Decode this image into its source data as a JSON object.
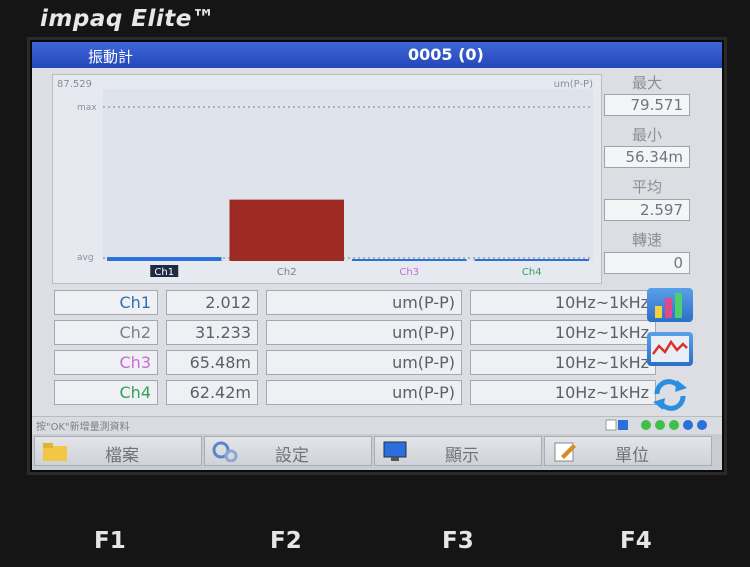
{
  "brand": "impaq Elite™",
  "title": {
    "app": "振動計",
    "counter": "0005 (0)"
  },
  "chart_data": {
    "type": "bar",
    "categories": [
      "Ch1",
      "Ch2",
      "Ch3",
      "Ch4"
    ],
    "values": [
      2.012,
      31.233,
      0.06548,
      0.06242
    ],
    "ylim": [
      0,
      87.529
    ],
    "y_max_label": "87.529",
    "unit": "um(P-P)",
    "max_line_label": "max",
    "avg_line_label": "avg",
    "selected": "Ch1",
    "bar_colors": {
      "Ch1": "#2a6fdb",
      "Ch2": "#9e2a24"
    }
  },
  "stats": {
    "max_label": "最大",
    "max_value": "79.571",
    "min_label": "最小",
    "min_value": "56.34m",
    "avg_label": "平均",
    "avg_value": "2.597",
    "speed_label": "轉速",
    "speed_value": "0"
  },
  "channels": [
    {
      "name": "Ch1",
      "value": "2.012",
      "unit": "um(P-P)",
      "range": "10Hz~1kHz",
      "color": "#2f6fb6"
    },
    {
      "name": "Ch2",
      "value": "31.233",
      "unit": "um(P-P)",
      "range": "10Hz~1kHz",
      "color": "#7a7f88"
    },
    {
      "name": "Ch3",
      "value": "65.48m",
      "unit": "um(P-P)",
      "range": "10Hz~1kHz",
      "color": "#c86bd6"
    },
    {
      "name": "Ch4",
      "value": "62.42m",
      "unit": "um(P-P)",
      "range": "10Hz~1kHz",
      "color": "#2fa35a"
    }
  ],
  "status_message": "按\"OK\"新增量測資料",
  "function_keys": [
    {
      "label": "檔案",
      "icon": "folder-icon"
    },
    {
      "label": "設定",
      "icon": "gears-icon"
    },
    {
      "label": "顯示",
      "icon": "monitor-icon"
    },
    {
      "label": "單位",
      "icon": "edit-icon"
    }
  ],
  "hardware_keys": [
    "F1",
    "F2",
    "F3",
    "F4"
  ]
}
